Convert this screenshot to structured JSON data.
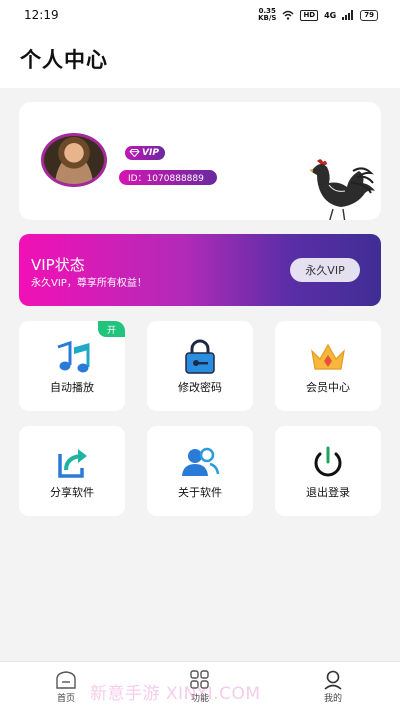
{
  "status_bar": {
    "time": "12:19",
    "speed_value": "0.35",
    "speed_unit": "KB/S",
    "hd_label": "HD",
    "network_label": "4G",
    "battery": "79"
  },
  "header": {
    "title": "个人中心"
  },
  "profile": {
    "vip_label": "VIP",
    "id_text": "ID：1070888889"
  },
  "vip_banner": {
    "title": "VIP状态",
    "subtitle": "永久VIP，尊享所有权益！",
    "tag": "永久VIP"
  },
  "tiles": [
    {
      "label": "自动播放",
      "badge": "开",
      "icon": "music-note-icon"
    },
    {
      "label": "修改密码",
      "icon": "lock-icon"
    },
    {
      "label": "会员中心",
      "icon": "crown-icon"
    },
    {
      "label": "分享软件",
      "icon": "share-icon"
    },
    {
      "label": "关于软件",
      "icon": "users-icon"
    },
    {
      "label": "退出登录",
      "icon": "power-icon"
    }
  ],
  "bottom_nav": [
    {
      "label": "首页",
      "icon": "home-icon"
    },
    {
      "label": "功能",
      "icon": "grid-icon"
    },
    {
      "label": "我的",
      "icon": "user-icon"
    }
  ],
  "watermark": "新意手游 XINYI.COM",
  "colors": {
    "accent_pink": "#f210b6",
    "accent_purple": "#3f2e94",
    "badge_green": "#22c37a",
    "icon_blue": "#2a7ad8"
  }
}
